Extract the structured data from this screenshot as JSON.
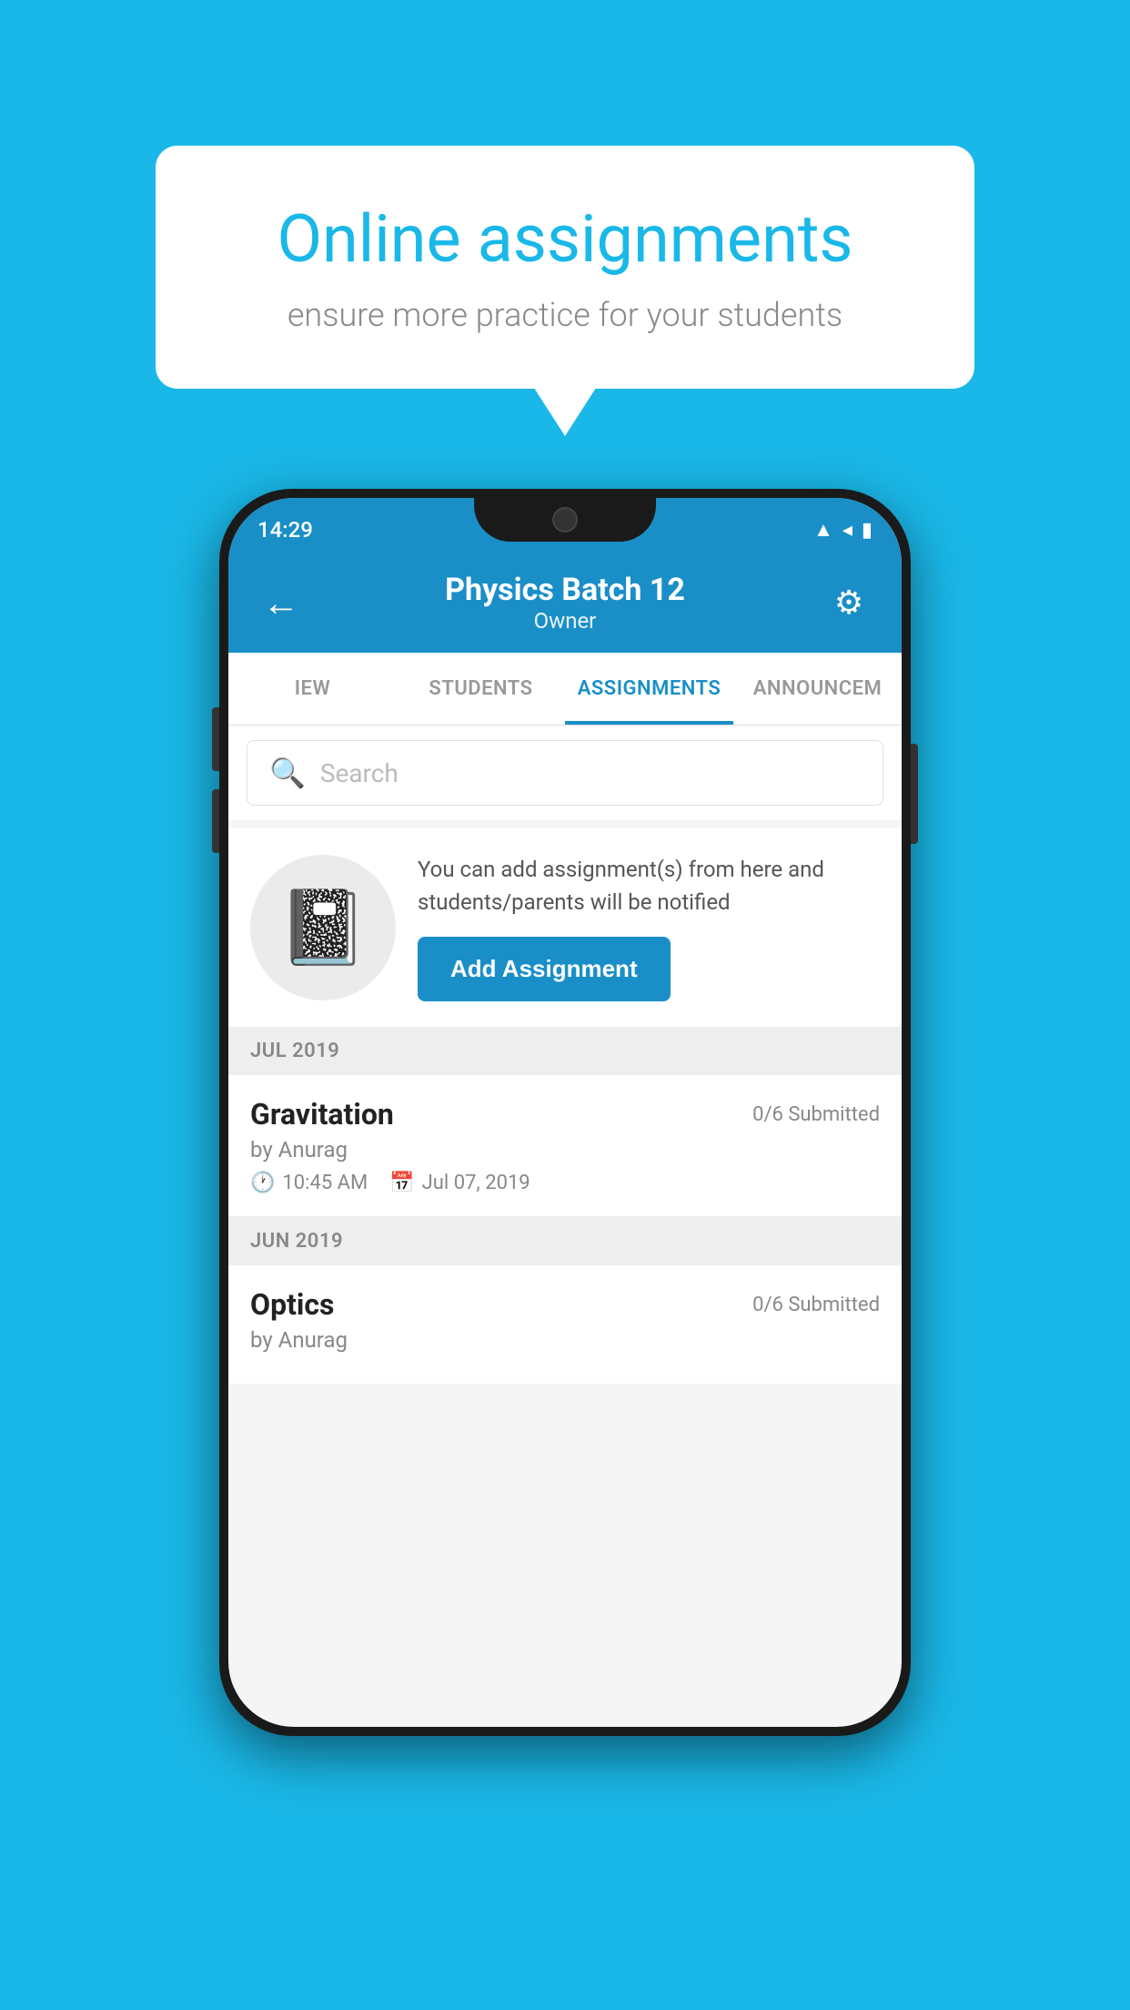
{
  "background_color": "#1ab8e8",
  "speech_bubble": {
    "title": "Online assignments",
    "subtitle": "ensure more practice for your students"
  },
  "status_bar": {
    "time": "14:29",
    "icons": [
      "wifi",
      "signal",
      "battery"
    ]
  },
  "header": {
    "title": "Physics Batch 12",
    "subtitle": "Owner"
  },
  "tabs": [
    {
      "label": "IEW",
      "active": false
    },
    {
      "label": "STUDENTS",
      "active": false
    },
    {
      "label": "ASSIGNMENTS",
      "active": true
    },
    {
      "label": "ANNOUNCEM",
      "active": false
    }
  ],
  "search": {
    "placeholder": "Search"
  },
  "promo": {
    "text": "You can add assignment(s) from here and students/parents will be notified",
    "button_label": "Add Assignment"
  },
  "sections": [
    {
      "month": "JUL 2019",
      "assignments": [
        {
          "name": "Gravitation",
          "submitted": "0/6 Submitted",
          "author": "by Anurag",
          "time": "10:45 AM",
          "date": "Jul 07, 2019"
        }
      ]
    },
    {
      "month": "JUN 2019",
      "assignments": [
        {
          "name": "Optics",
          "submitted": "0/6 Submitted",
          "author": "by Anurag",
          "time": "",
          "date": ""
        }
      ]
    }
  ]
}
